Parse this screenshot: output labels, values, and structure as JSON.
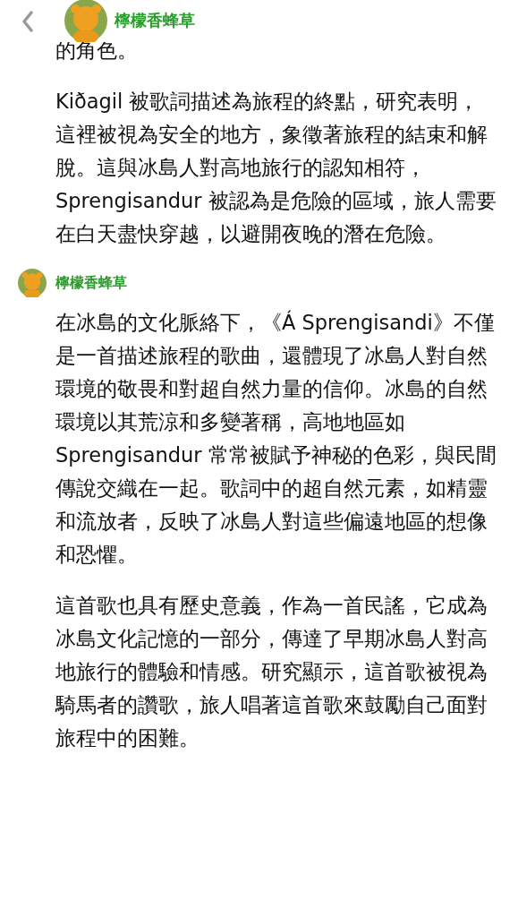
{
  "header": {
    "contact_name": "檸檬香蜂草"
  },
  "messages": [
    {
      "paragraphs": [
        "的角色。",
        "Kiðagil 被歌詞描述為旅程的終點，研究表明，這裡被視為安全的地方，象徵著旅程的結束和解脫。這與冰島人對高地旅行的認知相符，Sprengisandur 被認為是危險的區域，旅人需要在白天盡快穿越，以避開夜晚的潛在危險。"
      ]
    },
    {
      "sender": "檸檬香蜂草",
      "paragraphs": [
        "在冰島的文化脈絡下，《Á Sprengisandi》不僅是一首描述旅程的歌曲，還體現了冰島人對自然環境的敬畏和對超自然力量的信仰。冰島的自然環境以其荒涼和多變著稱，高地地區如 Sprengisandur 常常被賦予神秘的色彩，與民間傳說交織在一起。歌詞中的超自然元素，如精靈和流放者，反映了冰島人對這些偏遠地區的想像和恐懼。",
        "這首歌也具有歷史意義，作為一首民謠，它成為冰島文化記憶的一部分，傳達了早期冰島人對高地旅行的體驗和情感。研究顯示，這首歌被視為騎馬者的讚歌，旅人唱著這首歌來鼓勵自己面對旅程中的困難。"
      ]
    }
  ]
}
